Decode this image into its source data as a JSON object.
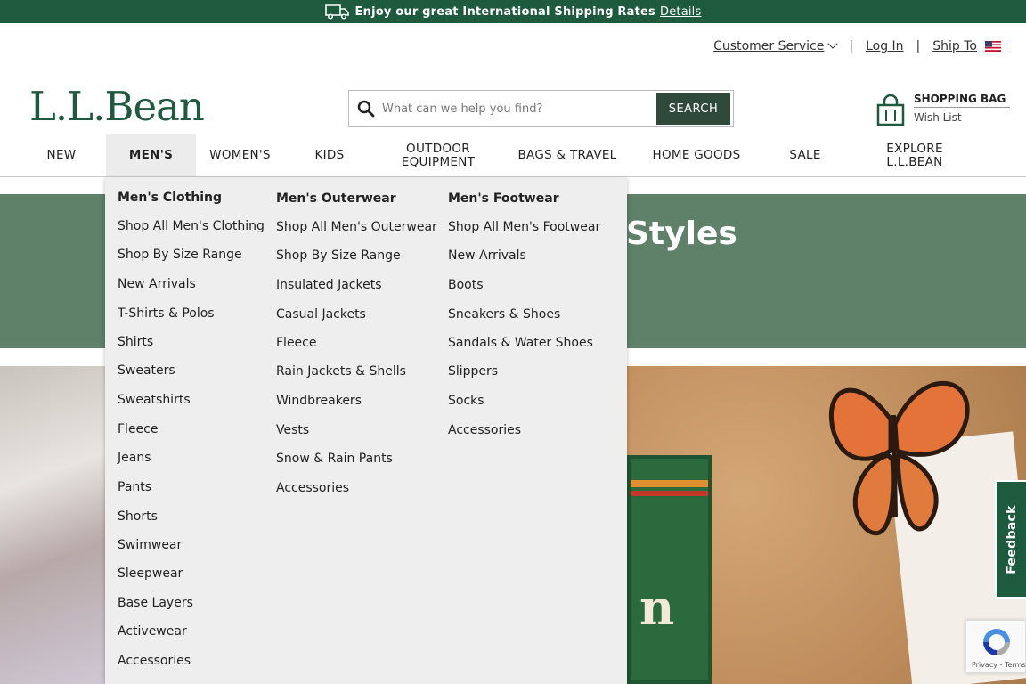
{
  "promo": {
    "text": "Enjoy our great International Shipping Rates",
    "details": "Details",
    "icon": "truck-icon"
  },
  "utility": {
    "customer_service": "Customer Service",
    "login": "Log In",
    "ship_to": "Ship To"
  },
  "logo": "L.L.Bean",
  "search": {
    "placeholder": "What can we help you find?",
    "button": "SEARCH"
  },
  "bag": {
    "title": "SHOPPING BAG",
    "wish_list": "Wish List"
  },
  "nav": {
    "items": [
      "NEW",
      "MEN'S",
      "WOMEN'S",
      "KIDS",
      "OUTDOOR EQUIPMENT",
      "BAGS & TRAVEL",
      "HOME GOODS",
      "SALE",
      "EXPLORE L.L.BEAN"
    ],
    "active": "MEN'S"
  },
  "hero": {
    "title_fragment": "Styles"
  },
  "menu": {
    "clothing": {
      "heading": "Men's Clothing",
      "links": [
        "Shop All Men's Clothing",
        "Shop By Size Range",
        "New Arrivals",
        "T-Shirts & Polos",
        "Shirts",
        "Sweaters",
        "Sweatshirts",
        "Fleece",
        "Jeans",
        "Pants",
        "Shorts",
        "Swimwear",
        "Sleepwear",
        "Base Layers",
        "Activewear",
        "Accessories"
      ]
    },
    "outerwear": {
      "heading": "Men's Outerwear",
      "links": [
        "Shop All Men's Outerwear",
        "Shop By Size Range",
        "Insulated Jackets",
        "Casual Jackets",
        "Fleece",
        "Rain Jackets & Shells",
        "Windbreakers",
        "Vests",
        "Snow & Rain Pants",
        "Accessories"
      ]
    },
    "footwear": {
      "heading": "Men's Footwear",
      "links": [
        "Shop All Men's Footwear",
        "New Arrivals",
        "Boots",
        "Sneakers & Shoes",
        "Sandals & Water Shoes",
        "Slippers",
        "Socks",
        "Accessories"
      ]
    }
  },
  "feedback": "Feedback",
  "recaptcha": "Privacy - Terms",
  "colors": {
    "brand_green": "#1d5a3e",
    "band_green": "#5f8069",
    "search_button": "#2f4a3a",
    "menu_bg": "#eeeeee"
  }
}
